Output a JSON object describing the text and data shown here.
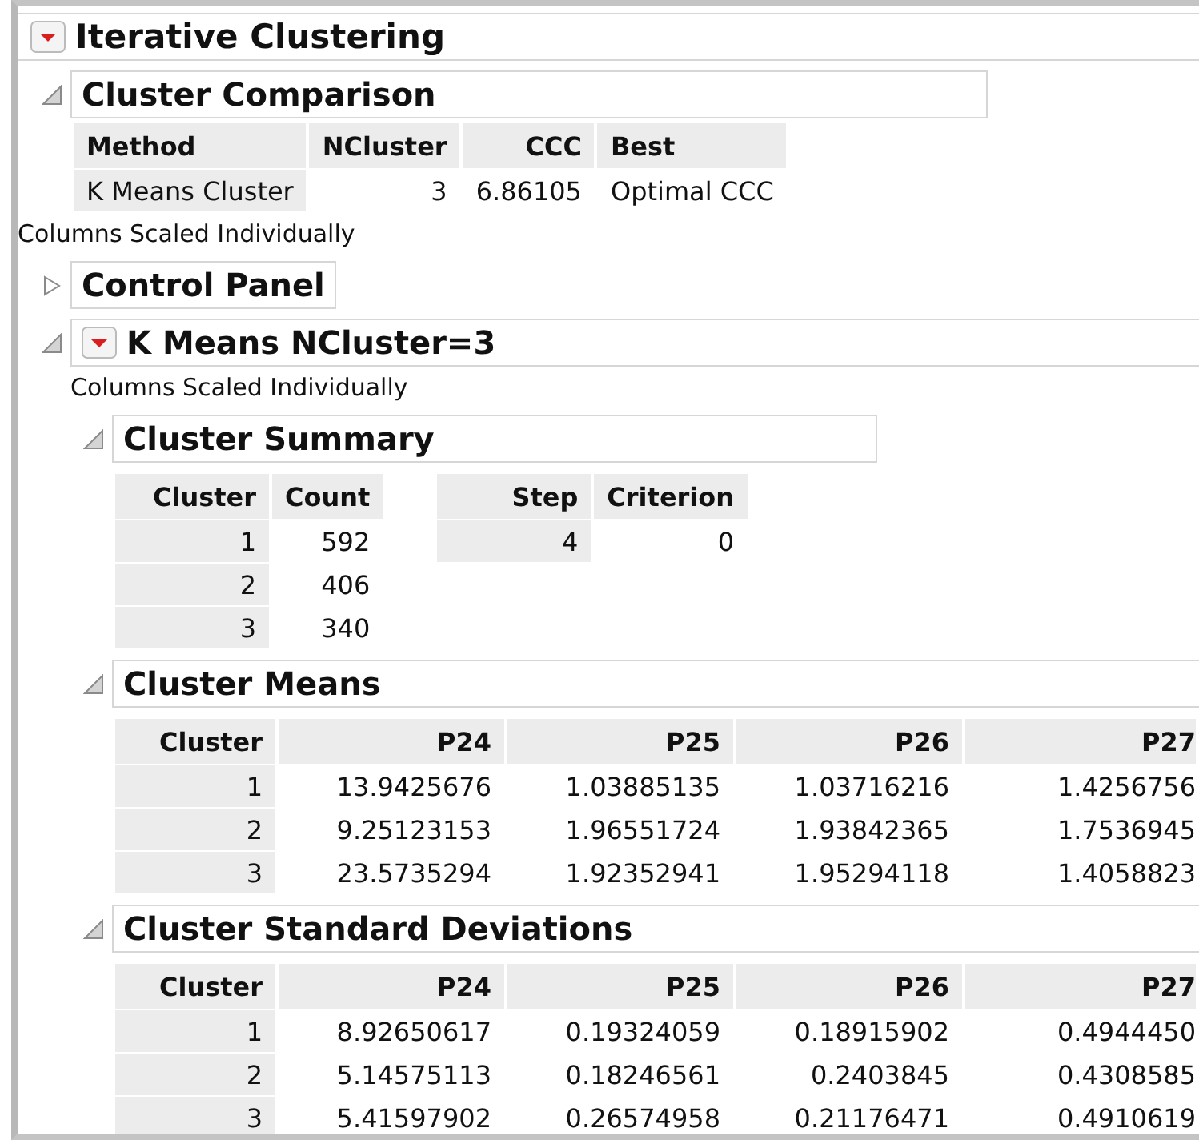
{
  "report": {
    "title": "Iterative Clustering",
    "menu": true,
    "children": [
      {
        "kind": "outline",
        "title": "Cluster Comparison",
        "expanded": true,
        "children": [
          {
            "kind": "table",
            "columns": [
              {
                "label": "Method",
                "numeric": false,
                "row_header": true
              },
              {
                "label": "NCluster",
                "numeric": true,
                "row_header": false
              },
              {
                "label": "CCC",
                "numeric": true,
                "row_header": false
              },
              {
                "label": "Best",
                "numeric": false,
                "row_header": false
              }
            ],
            "rows": [
              [
                "K Means Cluster",
                "3",
                "6.86105",
                "Optimal CCC"
              ]
            ]
          }
        ]
      },
      {
        "kind": "note",
        "text": "Columns Scaled Individually"
      },
      {
        "kind": "outline",
        "title": "Control Panel",
        "expanded": false
      },
      {
        "kind": "outline",
        "title": "K Means NCluster=3",
        "menu": true,
        "expanded": true,
        "children": [
          {
            "kind": "note",
            "text": "Columns Scaled Individually"
          },
          {
            "kind": "outline",
            "title": "Cluster Summary",
            "expanded": true,
            "children": [
              {
                "kind": "table",
                "columns": [
                  {
                    "label": "Cluster",
                    "numeric": true,
                    "row_header": true
                  },
                  {
                    "label": "Count",
                    "numeric": true,
                    "row_header": false
                  }
                ],
                "rows": [
                  [
                    "1",
                    "592"
                  ],
                  [
                    "2",
                    "406"
                  ],
                  [
                    "3",
                    "340"
                  ]
                ]
              },
              {
                "kind": "table",
                "columns": [
                  {
                    "label": "Step",
                    "numeric": true,
                    "row_header": true
                  },
                  {
                    "label": "Criterion",
                    "numeric": true,
                    "row_header": false
                  }
                ],
                "rows": [
                  [
                    "4",
                    "0"
                  ]
                ]
              }
            ]
          },
          {
            "kind": "outline",
            "title": "Cluster Means",
            "expanded": true,
            "children": [
              {
                "kind": "table",
                "columns": [
                  {
                    "label": "Cluster",
                    "numeric": true,
                    "row_header": true
                  },
                  {
                    "label": "P24",
                    "numeric": true,
                    "row_header": false
                  },
                  {
                    "label": "P25",
                    "numeric": true,
                    "row_header": false
                  },
                  {
                    "label": "P26",
                    "numeric": true,
                    "row_header": false
                  },
                  {
                    "label": "P27",
                    "numeric": true,
                    "row_header": false
                  }
                ],
                "rows": [
                  [
                    "1",
                    "13.9425676",
                    "1.03885135",
                    "1.03716216",
                    "1.4256756"
                  ],
                  [
                    "2",
                    "9.25123153",
                    "1.96551724",
                    "1.93842365",
                    "1.7536945"
                  ],
                  [
                    "3",
                    "23.5735294",
                    "1.92352941",
                    "1.95294118",
                    "1.4058823"
                  ]
                ]
              }
            ]
          },
          {
            "kind": "outline",
            "title": "Cluster Standard Deviations",
            "expanded": true,
            "children": [
              {
                "kind": "table",
                "columns": [
                  {
                    "label": "Cluster",
                    "numeric": true,
                    "row_header": true
                  },
                  {
                    "label": "P24",
                    "numeric": true,
                    "row_header": false
                  },
                  {
                    "label": "P25",
                    "numeric": true,
                    "row_header": false
                  },
                  {
                    "label": "P26",
                    "numeric": true,
                    "row_header": false
                  },
                  {
                    "label": "P27",
                    "numeric": true,
                    "row_header": false
                  }
                ],
                "rows": [
                  [
                    "1",
                    "8.92650617",
                    "0.19324059",
                    "0.18915902",
                    "0.4944450"
                  ],
                  [
                    "2",
                    "5.14575113",
                    "0.18246561",
                    "0.2403845",
                    "0.4308585"
                  ],
                  [
                    "3",
                    "5.41597902",
                    "0.26574958",
                    "0.21176471",
                    "0.4910619"
                  ]
                ]
              }
            ]
          }
        ]
      }
    ]
  }
}
